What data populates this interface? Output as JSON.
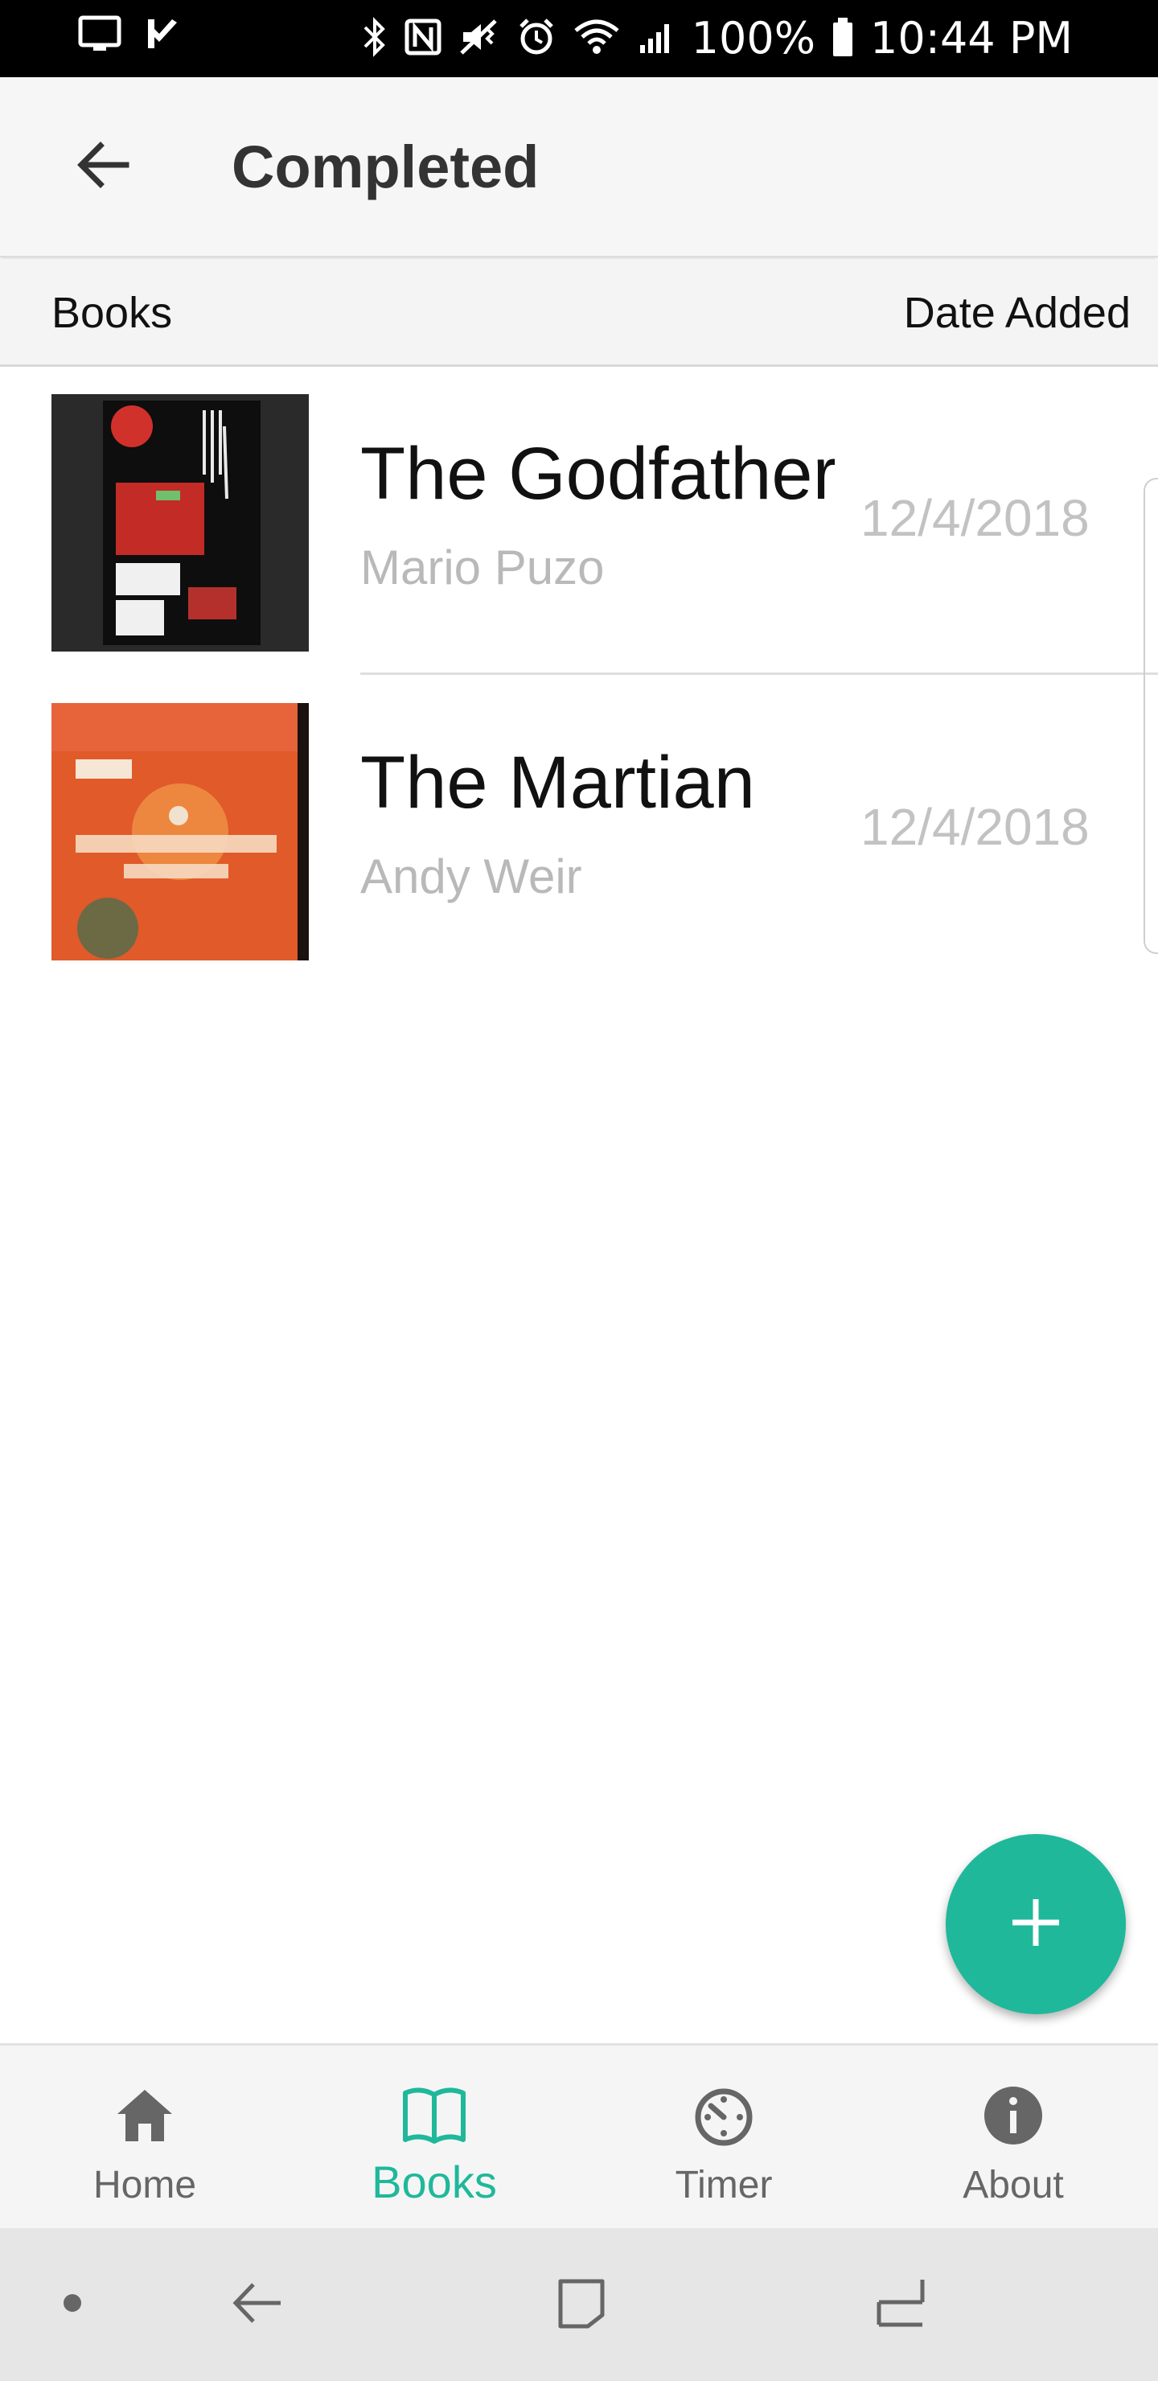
{
  "status_bar": {
    "battery": "100%",
    "time": "10:44 PM"
  },
  "app_bar": {
    "title": "Completed"
  },
  "columns": {
    "books": "Books",
    "date_added": "Date Added"
  },
  "books": [
    {
      "title": "The Godfather",
      "author": "Mario Puzo",
      "date": "12/4/2018",
      "cover_colors": {
        "bg": "#141414",
        "accent": "#d1312b"
      }
    },
    {
      "title": "The Martian",
      "author": "Andy Weir",
      "date": "12/4/2018",
      "cover_colors": {
        "bg": "#e05a2a",
        "accent": "#f29a4a"
      }
    }
  ],
  "bottom_nav": {
    "items": [
      {
        "label": "Home",
        "icon": "home-icon",
        "active": false
      },
      {
        "label": "Books",
        "icon": "book-open-icon",
        "active": true
      },
      {
        "label": "Timer",
        "icon": "timer-icon",
        "active": false
      },
      {
        "label": "About",
        "icon": "info-icon",
        "active": false
      }
    ]
  },
  "colors": {
    "accent": "#1fb89a",
    "inactive": "#666666"
  }
}
